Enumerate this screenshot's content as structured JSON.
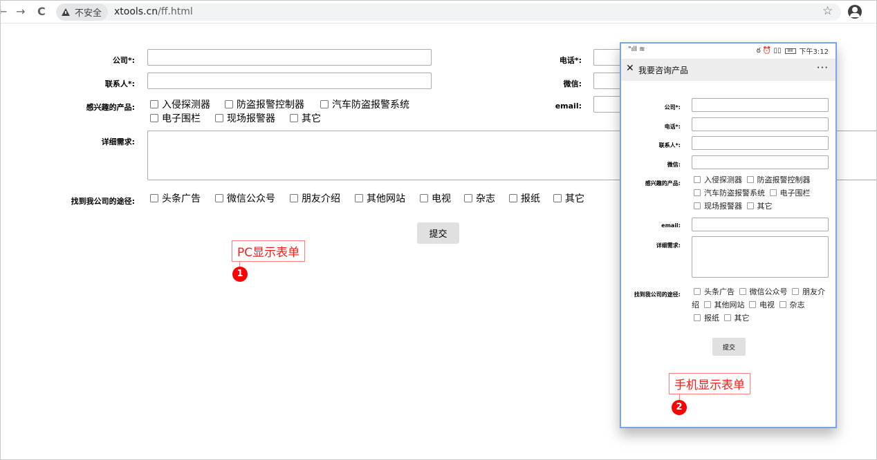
{
  "browser": {
    "back": "←",
    "forward": "→",
    "reload": "C",
    "security_label": "不安全",
    "url_host": "xtools.cn",
    "url_path": "/ff.html",
    "star": "☆",
    "menu": "⋮"
  },
  "pc_form": {
    "company_label": "公司*:",
    "phone_label": "电话*:",
    "contact_label": "联系人*:",
    "wechat_label": "微信:",
    "products_label": "感兴趣的产品:",
    "email_label": "email:",
    "details_label": "详细需求:",
    "source_label": "找到我公司的途径:",
    "products": [
      "入侵探测器",
      "防盗报警控制器",
      "汽车防盗报警系统",
      "电子围栏",
      "现场报警器",
      "其它"
    ],
    "sources": [
      "头条广告",
      "微信公众号",
      "朋友介绍",
      "其他网站",
      "电视",
      "杂志",
      "报纸",
      "其它"
    ],
    "submit": "提交"
  },
  "annotations": {
    "pc_label": "PC显示表单",
    "pc_badge": "1",
    "mobile_label": "手机显示表单",
    "mobile_badge": "2"
  },
  "mobile": {
    "status_left": "\"ıll ≋",
    "status_icons": "ఠ ⏰ ▯▯",
    "battery": "88",
    "time": "下午3:12",
    "close": "✕",
    "title": "我要咨询产品",
    "more": "···",
    "company_label": "公司*:",
    "phone_label": "电话*:",
    "contact_label": "联系人*:",
    "wechat_label": "微信:",
    "products_label": "感兴趣的产品:",
    "email_label": "email:",
    "details_label": "详细需求:",
    "source_label": "找到我公司的途径:",
    "products": [
      "入侵探测器",
      "防盗报警控制器",
      "汽车防盗报警系统",
      "电子围栏",
      "现场报警器",
      "其它"
    ],
    "sources": [
      "头条广告",
      "微信公众号",
      "朋友介绍",
      "其他网站",
      "电视",
      "杂志",
      "报纸",
      "其它"
    ],
    "submit": "提交"
  }
}
